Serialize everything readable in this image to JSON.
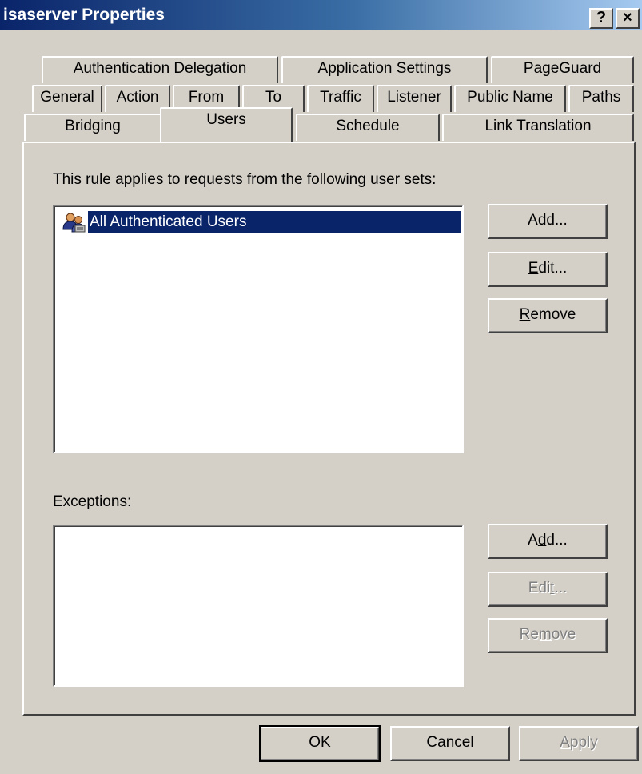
{
  "window": {
    "title": "isaserver Properties",
    "help_button": "?",
    "close_button": "×"
  },
  "tabs": {
    "row1": [
      "Authentication Delegation",
      "Application Settings",
      "PageGuard"
    ],
    "row2": [
      "General",
      "Action",
      "From",
      "To",
      "Traffic",
      "Listener",
      "Public Name",
      "Paths"
    ],
    "row3": [
      "Bridging",
      "Users",
      "Schedule",
      "Link Translation"
    ],
    "selected": "Users"
  },
  "users": {
    "instruction": "This rule applies to requests from the following user sets:",
    "items": [
      {
        "label": "All Authenticated Users",
        "icon": "user-group-icon",
        "selected": true
      }
    ],
    "buttons": {
      "add": {
        "pre": "Add...",
        "ul": "",
        "post": ""
      },
      "edit": {
        "pre": "",
        "ul": "E",
        "post": "dit..."
      },
      "remove": {
        "pre": "",
        "ul": "R",
        "post": "emove"
      }
    }
  },
  "exceptions": {
    "label": "Exceptions:",
    "items": [],
    "buttons": {
      "add": {
        "pre": "A",
        "ul": "d",
        "post": "d...",
        "enabled": true
      },
      "edit": {
        "pre": "Edi",
        "ul": "t",
        "post": "...",
        "enabled": false
      },
      "remove": {
        "pre": "Re",
        "ul": "m",
        "post": "ove",
        "enabled": false
      }
    }
  },
  "footer": {
    "ok": "OK",
    "cancel": "Cancel",
    "apply": {
      "pre": "",
      "ul": "A",
      "post": "pply",
      "enabled": false
    }
  },
  "colors": {
    "title_gradient_start": "#0a246a",
    "title_gradient_end": "#a6caf0",
    "selection": "#0a246a",
    "face": "#d4d0c8"
  }
}
